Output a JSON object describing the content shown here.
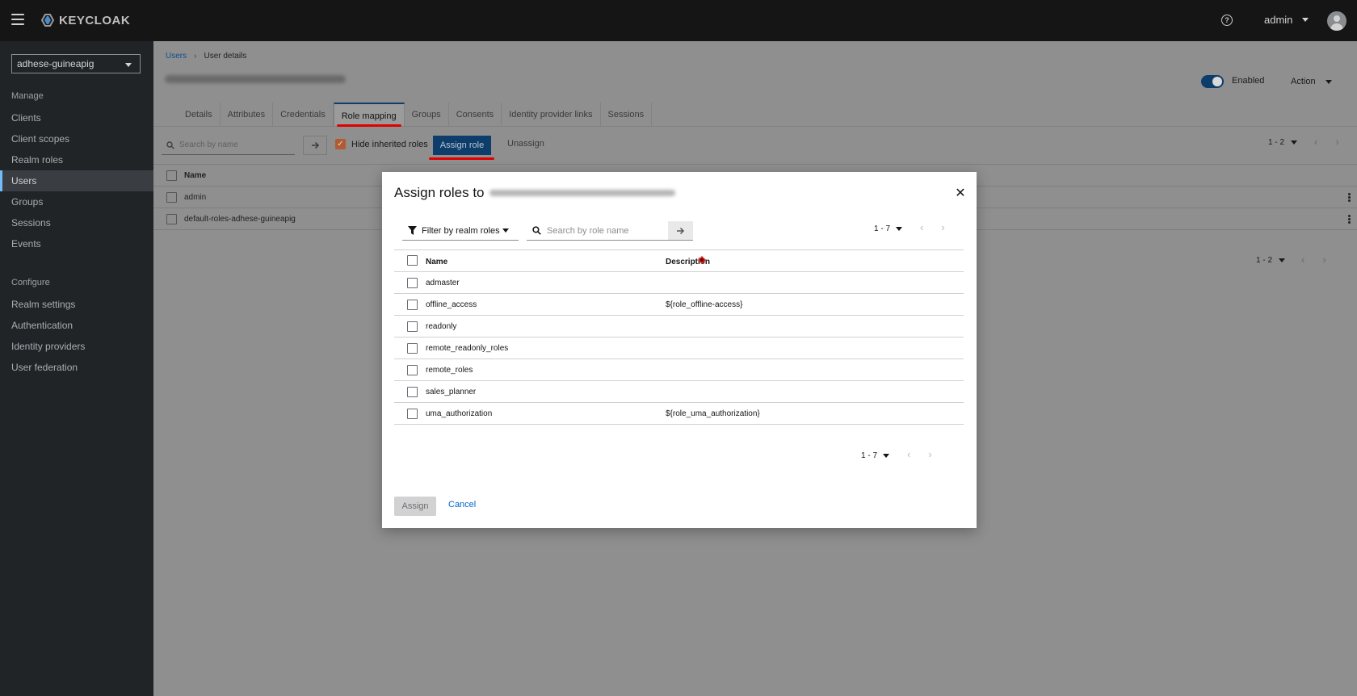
{
  "header": {
    "logo_text": "KEYCLOAK",
    "user_name": "admin"
  },
  "sidebar": {
    "realm": "adhese-guineapig",
    "sections": [
      {
        "title": "Manage",
        "items": [
          "Clients",
          "Client scopes",
          "Realm roles",
          "Users",
          "Groups",
          "Sessions",
          "Events"
        ]
      },
      {
        "title": "Configure",
        "items": [
          "Realm settings",
          "Authentication",
          "Identity providers",
          "User federation"
        ]
      }
    ],
    "active_item": "Users"
  },
  "page": {
    "breadcrumb": [
      "Users",
      "User details"
    ],
    "enabled_label": "Enabled",
    "action_label": "Action",
    "tabs": [
      "Details",
      "Attributes",
      "Credentials",
      "Role mapping",
      "Groups",
      "Consents",
      "Identity provider links",
      "Sessions"
    ],
    "active_tab": "Role mapping",
    "search_placeholder": "Search by name",
    "hide_inherited_label": "Hide inherited roles",
    "assign_role_label": "Assign role",
    "unassign_label": "Unassign",
    "pagination_top": "1 - 2",
    "pagination_bottom": "1 - 2",
    "table_header_name": "Name",
    "rows": [
      "admin",
      "default-roles-adhese-guineapig"
    ]
  },
  "modal": {
    "title": "Assign roles to",
    "filter_label": "Filter by realm roles",
    "search_placeholder": "Search by role name",
    "pagination": "1 - 7",
    "col_name": "Name",
    "col_description": "Description",
    "rows": [
      {
        "name": "admaster",
        "description": ""
      },
      {
        "name": "offline_access",
        "description": "${role_offline-access}"
      },
      {
        "name": "readonly",
        "description": ""
      },
      {
        "name": "remote_readonly_roles",
        "description": ""
      },
      {
        "name": "remote_roles",
        "description": ""
      },
      {
        "name": "sales_planner",
        "description": ""
      },
      {
        "name": "uma_authorization",
        "description": "${role_uma_authorization}"
      }
    ],
    "assign_label": "Assign",
    "cancel_label": "Cancel"
  },
  "colors": {
    "accent": "#0066cc",
    "annotation": "#e00000",
    "header_bg": "#151515",
    "sidebar_bg": "#212427"
  }
}
